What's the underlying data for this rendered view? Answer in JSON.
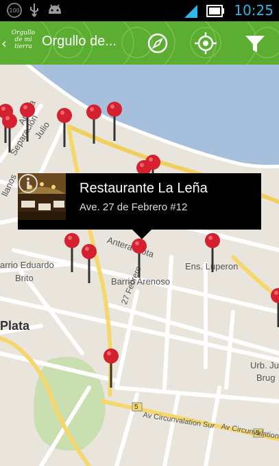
{
  "status_bar": {
    "battery_badge": "100",
    "time": "10:25",
    "icons": [
      "battery-100-icon",
      "usb-icon",
      "android-icon",
      "signal-icon",
      "battery-icon"
    ]
  },
  "action_bar": {
    "logo_text": "Orgullo de mi tierra",
    "title": "Orgullo de...",
    "icons": [
      "back-chevron-icon",
      "compass-icon",
      "locate-icon",
      "filter-icon"
    ],
    "color": "#5cae33"
  },
  "map": {
    "labels": {
      "antera": "Antera",
      "separacion": "Separación",
      "julio": "Julio",
      "llanos": "llanos",
      "antera_mota": "Antera Mota",
      "barrio_eduardo": "arrio Eduardo",
      "brito": "Brito",
      "barrio_arenoso": "Barrio Arenoso",
      "ens_luperon": "Ens. Luperon",
      "febrero": "27 Febrero",
      "plata": "Plata",
      "urb_ju": "Urb. Ju",
      "brug": "Brug",
      "circ1": "Av Circunvalation Sur",
      "circ2": "Av Circunvalation",
      "route5a": "5",
      "route5b": "5"
    },
    "pin_color": "#d4202f"
  },
  "info_window": {
    "title": "Restaurante La Leña",
    "subtitle": "Ave. 27 de Febrero #12"
  }
}
